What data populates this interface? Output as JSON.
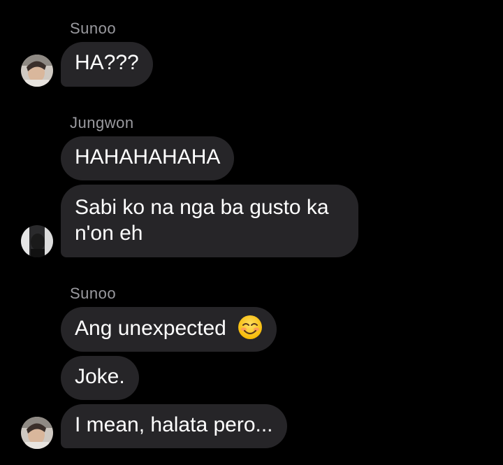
{
  "colors": {
    "background": "#000000",
    "bubble": "#262528",
    "sender_name": "#9a9a9f",
    "text": "#ffffff"
  },
  "thread": {
    "groups": [
      {
        "sender": "Sunoo",
        "avatar": "avatar-sunoo",
        "messages": [
          "HA???"
        ]
      },
      {
        "sender": "Jungwon",
        "avatar": "avatar-jungwon",
        "messages": [
          "HAHAHAHAHA",
          "Sabi ko na nga ba gusto ka n'on eh"
        ]
      },
      {
        "sender": "Sunoo",
        "avatar": "avatar-sunoo",
        "messages": [
          "Ang unexpected",
          "Joke.",
          "I mean, halata pero..."
        ],
        "emoji_icon": "smiling-face-with-smiling-eyes-icon"
      }
    ]
  }
}
